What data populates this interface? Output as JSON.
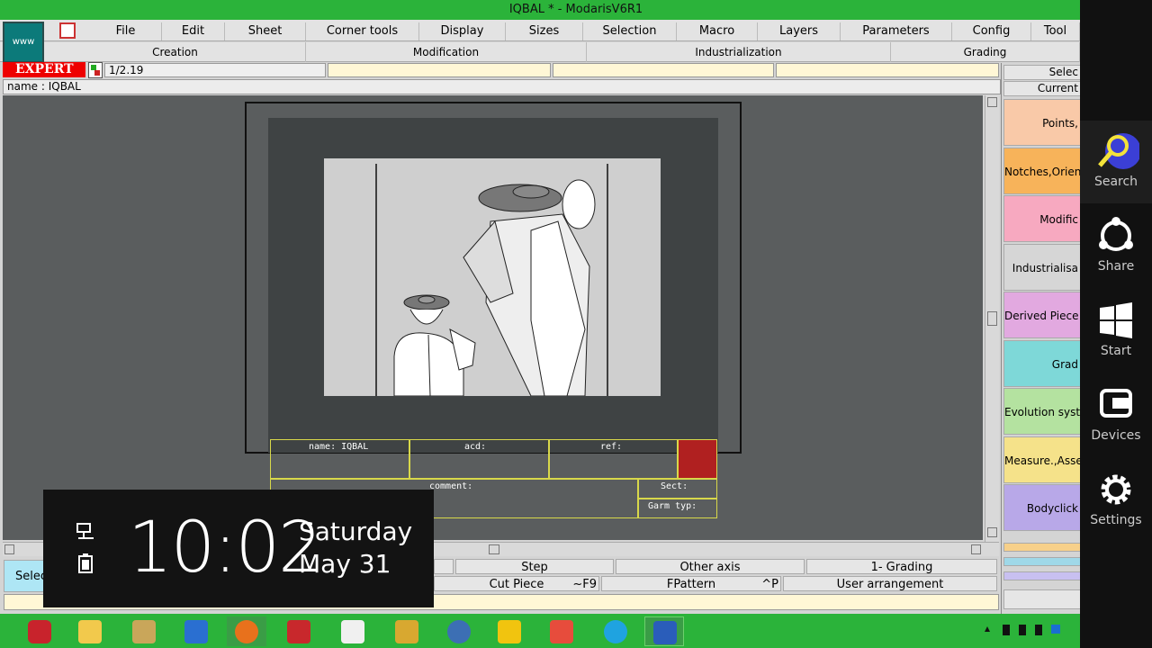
{
  "window": {
    "title": "IQBAL * - ModarisV6R1"
  },
  "menu": [
    "File",
    "Edit",
    "Sheet",
    "Corner tools",
    "Display",
    "Sizes",
    "Selection",
    "Macro",
    "Layers",
    "Parameters",
    "Config",
    "Tool"
  ],
  "submenu": [
    "Creation",
    "Modification",
    "Industrialization",
    "Grading"
  ],
  "toolbar": {
    "www_label": "www",
    "expert_label": "EXPERT",
    "version": "1/2.19"
  },
  "namebar": {
    "text": "name : IQBAL"
  },
  "cartouche": {
    "name": "name: IQBAL",
    "acd": "acd:",
    "ref": "ref:",
    "comment": "comment:",
    "sect": "Sect:",
    "garm": "Garm typ:"
  },
  "right_panel": {
    "selec": "Selec",
    "current": "Current",
    "items": [
      {
        "label": "Points,",
        "color": "#f9c9a8"
      },
      {
        "label": "Notches,Orien",
        "color": "#f7b35a"
      },
      {
        "label": "Modific",
        "color": "#f7a9c0"
      },
      {
        "label": "Industrialisa",
        "color": "#d6d6d6"
      },
      {
        "label": "Derived Piece",
        "color": "#e2a9e0"
      },
      {
        "label": "Grad",
        "color": "#7ed8d8"
      },
      {
        "label": "Evolution syst",
        "color": "#b4e2a0"
      },
      {
        "label": "Measure.,Asse",
        "color": "#f5e28a"
      },
      {
        "label": "Bodyclick",
        "color": "#b8a8e8"
      }
    ]
  },
  "bottom": {
    "selection": "Selec",
    "step": "Step",
    "other_axis": "Other axis",
    "grading": "1- Grading",
    "cut_piece": "Cut Piece",
    "cut_piece_key": "~F9",
    "fpattern": "FPattern",
    "fpattern_key": "^P",
    "user_arrangement": "User arrangement"
  },
  "clock": {
    "time": "10:02",
    "day": "Saturday",
    "date": "May 31"
  },
  "charms": [
    "Search",
    "Share",
    "Start",
    "Devices",
    "Settings"
  ]
}
